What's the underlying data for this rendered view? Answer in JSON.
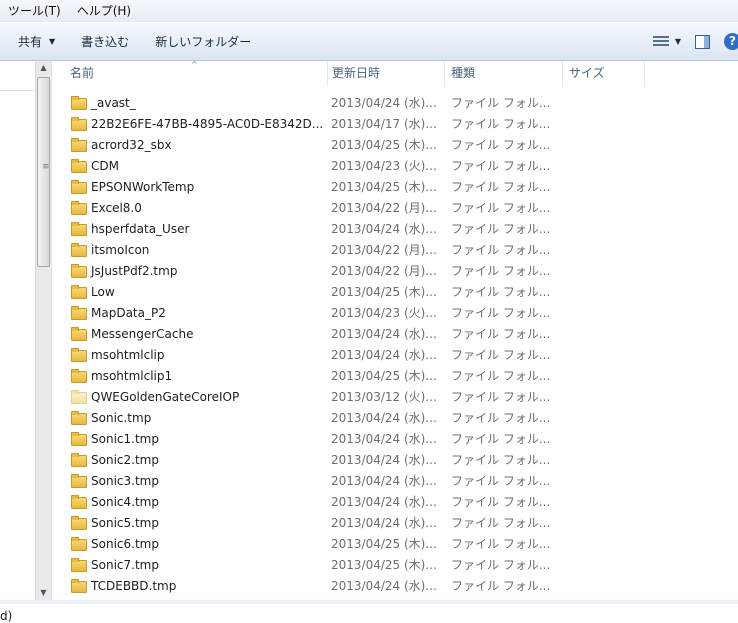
{
  "menu": [
    "ツール(T)",
    "ヘルプ(H)"
  ],
  "toolbar": {
    "share_label": "共有",
    "burn_label": "書き込む",
    "new_folder_label": "新しいフォルダー",
    "view_icon": "view-options-icon",
    "pane_icon": "preview-pane-icon",
    "help_icon": "help-icon",
    "help_glyph": "?"
  },
  "nav": {
    "partial_text": "d)"
  },
  "columns": {
    "name": "名前",
    "date": "更新日時",
    "type": "種類",
    "size": "サイズ"
  },
  "sort_indicator": "^",
  "files": [
    {
      "name": "_avast_",
      "date": "2013/04/24 (水)...",
      "type": "ファイル フォル..."
    },
    {
      "name": "22B2E6FE-47BB-4895-AC0D-E8342D...",
      "date": "2013/04/17 (水)...",
      "type": "ファイル フォル..."
    },
    {
      "name": "acrord32_sbx",
      "date": "2013/04/25 (木)...",
      "type": "ファイル フォル..."
    },
    {
      "name": "CDM",
      "date": "2013/04/23 (火)...",
      "type": "ファイル フォル..."
    },
    {
      "name": "EPSONWorkTemp",
      "date": "2013/04/25 (木)...",
      "type": "ファイル フォル..."
    },
    {
      "name": "Excel8.0",
      "date": "2013/04/22 (月)...",
      "type": "ファイル フォル..."
    },
    {
      "name": "hsperfdata_User",
      "date": "2013/04/24 (水)...",
      "type": "ファイル フォル..."
    },
    {
      "name": "itsmoIcon",
      "date": "2013/04/22 (月)...",
      "type": "ファイル フォル..."
    },
    {
      "name": "JsJustPdf2.tmp",
      "date": "2013/04/22 (月)...",
      "type": "ファイル フォル..."
    },
    {
      "name": "Low",
      "date": "2013/04/25 (木)...",
      "type": "ファイル フォル..."
    },
    {
      "name": "MapData_P2",
      "date": "2013/04/23 (火)...",
      "type": "ファイル フォル..."
    },
    {
      "name": "MessengerCache",
      "date": "2013/04/24 (水)...",
      "type": "ファイル フォル..."
    },
    {
      "name": "msohtmlclip",
      "date": "2013/04/24 (水)...",
      "type": "ファイル フォル..."
    },
    {
      "name": "msohtmlclip1",
      "date": "2013/04/25 (木)...",
      "type": "ファイル フォル..."
    },
    {
      "name": "QWEGoldenGateCoreIOP",
      "date": "2013/03/12 (火)...",
      "type": "ファイル フォル...",
      "faded": true
    },
    {
      "name": "Sonic.tmp",
      "date": "2013/04/24 (水)...",
      "type": "ファイル フォル..."
    },
    {
      "name": "Sonic1.tmp",
      "date": "2013/04/24 (水)...",
      "type": "ファイル フォル..."
    },
    {
      "name": "Sonic2.tmp",
      "date": "2013/04/24 (水)...",
      "type": "ファイル フォル..."
    },
    {
      "name": "Sonic3.tmp",
      "date": "2013/04/24 (水)...",
      "type": "ファイル フォル..."
    },
    {
      "name": "Sonic4.tmp",
      "date": "2013/04/24 (水)...",
      "type": "ファイル フォル..."
    },
    {
      "name": "Sonic5.tmp",
      "date": "2013/04/24 (水)...",
      "type": "ファイル フォル..."
    },
    {
      "name": "Sonic6.tmp",
      "date": "2013/04/25 (木)...",
      "type": "ファイル フォル..."
    },
    {
      "name": "Sonic7.tmp",
      "date": "2013/04/25 (木)...",
      "type": "ファイル フォル..."
    },
    {
      "name": "TCDEBBD.tmp",
      "date": "2013/04/24 (水)...",
      "type": "ファイル フォル..."
    }
  ]
}
